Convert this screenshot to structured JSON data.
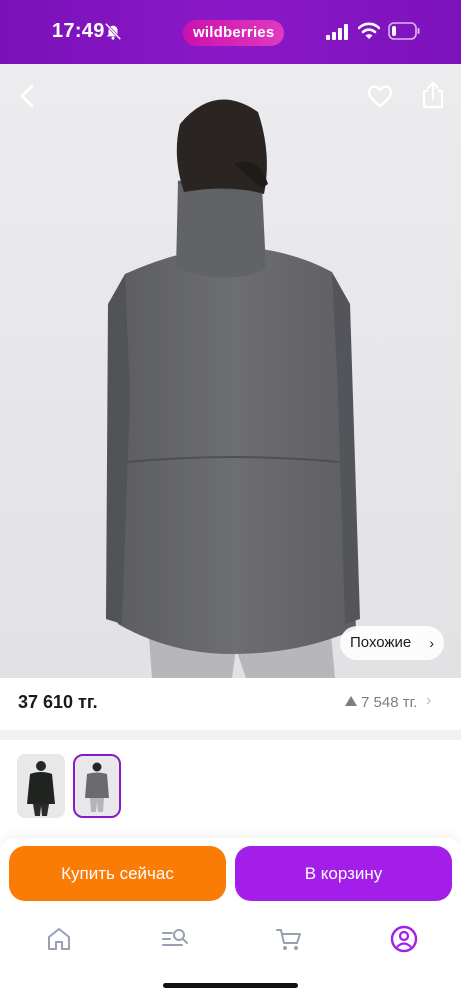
{
  "status_bar": {
    "time": "17:49",
    "brand": "wildberries",
    "icons": [
      "bell-off-icon",
      "signal-icon",
      "wifi-icon",
      "battery-icon"
    ],
    "battery_level": 0.2
  },
  "header": {
    "icons": [
      "back-chevron-icon",
      "heart-icon",
      "share-icon"
    ]
  },
  "gallery": {
    "image_count": 4,
    "current_index": 1,
    "similar_label": "Похожие",
    "similar_chevron": "›"
  },
  "price": {
    "current": "37 610 тг.",
    "change": "7 548 тг.",
    "chevron": "›"
  },
  "variants": {
    "count": 2,
    "selected_index": 1,
    "accent_color": "#8b18c8"
  },
  "actions": {
    "buy_now": "Купить сейчас",
    "add_to_cart": "В корзину",
    "buy_now_color": "#fb7b07",
    "cart_color": "#a31ee8"
  },
  "tabbar": {
    "items": [
      {
        "icon": "home-icon",
        "active": false
      },
      {
        "icon": "catalog-search-icon",
        "active": false
      },
      {
        "icon": "cart-icon",
        "active": false
      },
      {
        "icon": "profile-icon",
        "active": true
      }
    ],
    "active_color": "#a31ee8"
  },
  "colors": {
    "brand_purple": "#8b18c8",
    "brand_pink": "#cb11ab"
  }
}
